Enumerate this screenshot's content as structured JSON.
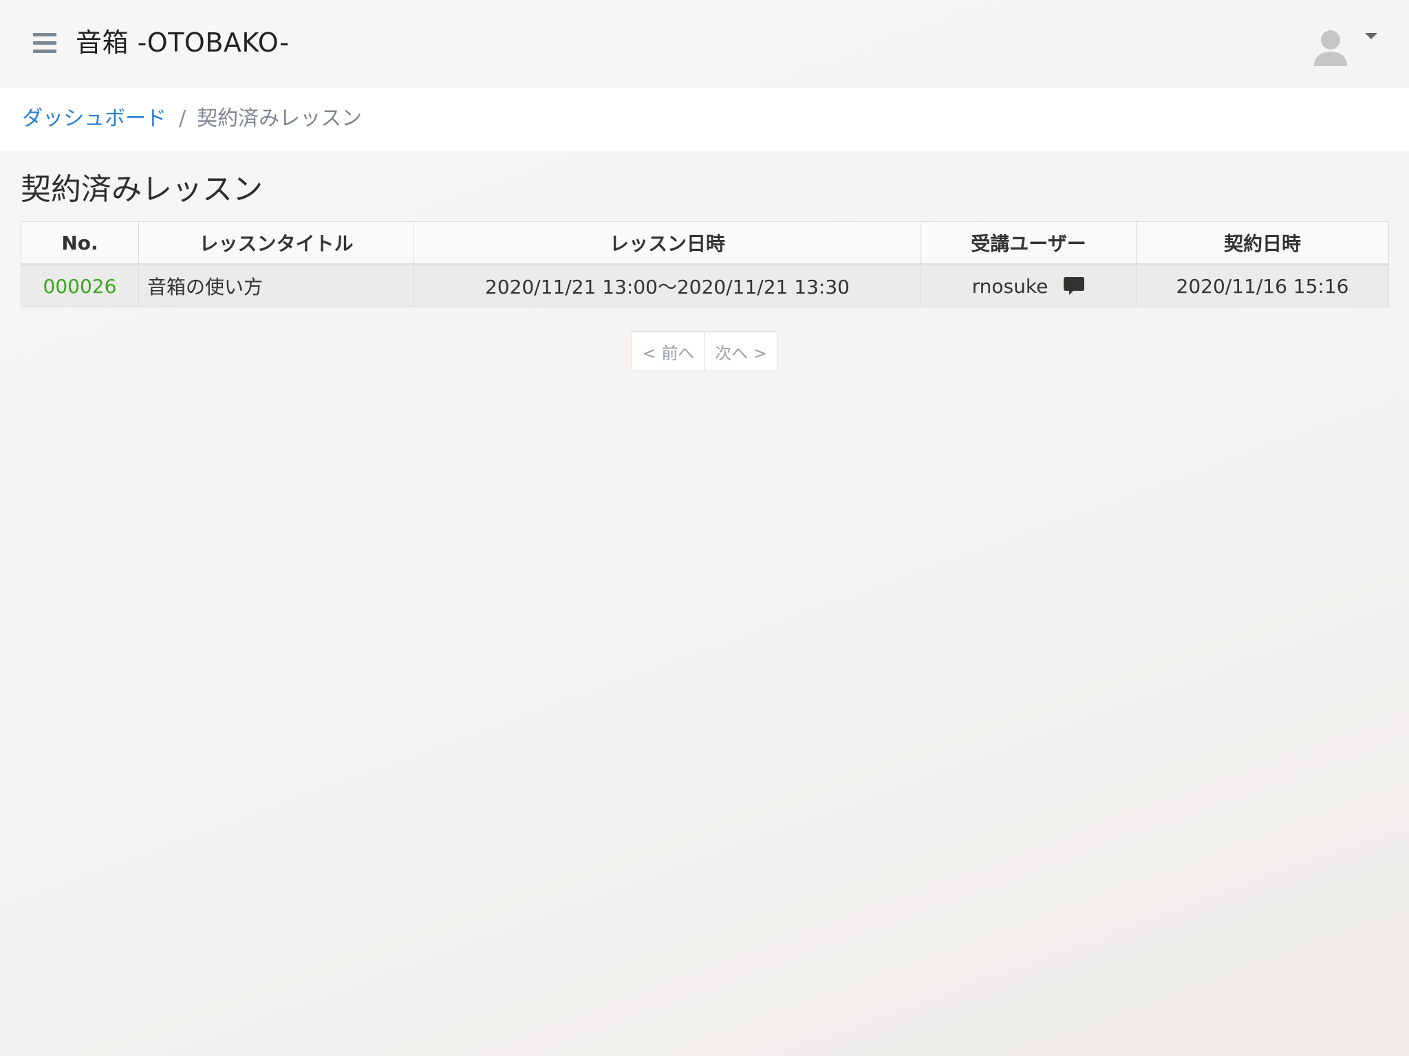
{
  "header": {
    "app_title": "音箱 -OTOBAKO-",
    "menu_icon": "hamburger-menu-icon",
    "avatar_icon": "user-avatar-icon",
    "dropdown_icon": "caret-down-icon"
  },
  "breadcrumb": {
    "items": [
      {
        "label": "ダッシュボード",
        "link": true
      },
      {
        "label": "契約済みレッスン",
        "link": false
      }
    ],
    "separator": "/"
  },
  "page": {
    "title": "契約済みレッスン"
  },
  "table": {
    "columns": [
      "No.",
      "レッスンタイトル",
      "レッスン日時",
      "受講ユーザー",
      "契約日時"
    ],
    "rows": [
      {
        "no": "000026",
        "title": "音箱の使い方",
        "lesson_datetime": "2020/11/21 13:00〜2020/11/21 13:30",
        "user": "rnosuke",
        "user_icon": "chat-bubble-icon",
        "contract_datetime": "2020/11/16 15:16"
      }
    ]
  },
  "pagination": {
    "prev_label": "< 前へ",
    "next_label": "次へ >"
  },
  "colors": {
    "link_blue": "#2a7fd4",
    "id_green": "#3aa61e",
    "row_bg": "#ebebea"
  }
}
